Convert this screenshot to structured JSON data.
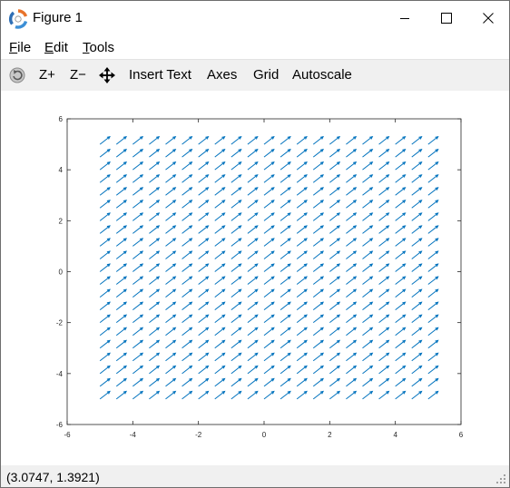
{
  "window": {
    "title": "Figure 1"
  },
  "menu": {
    "items": [
      "File",
      "Edit",
      "Tools"
    ],
    "mnemonics": [
      "F",
      "E",
      "T"
    ]
  },
  "toolbar": {
    "rotate_icon": "rotate-icon",
    "zoom_in_label": "Z+",
    "zoom_out_label": "Z−",
    "pan_icon": "pan-icon",
    "insert_text_label": "Insert Text",
    "axes_label": "Axes",
    "grid_label": "Grid",
    "autoscale_label": "Autoscale"
  },
  "status": {
    "coordinates": "(3.0747, 1.3921)"
  },
  "chart_data": {
    "type": "quiver",
    "xlim": [
      -6,
      6
    ],
    "ylim": [
      -6,
      6
    ],
    "xticks": [
      "-6",
      "-4",
      "-2",
      "0",
      "2",
      "4",
      "6"
    ],
    "yticks": [
      "-6",
      "-4",
      "-2",
      "0",
      "2",
      "4",
      "6"
    ],
    "x": {
      "start": -5,
      "stop": 5,
      "count": 21
    },
    "y": {
      "start": -5,
      "stop": 5,
      "count": 21
    },
    "u": 0.3,
    "v": 0.3,
    "arrow_color": "#0072bd",
    "grid": false,
    "box": true
  }
}
